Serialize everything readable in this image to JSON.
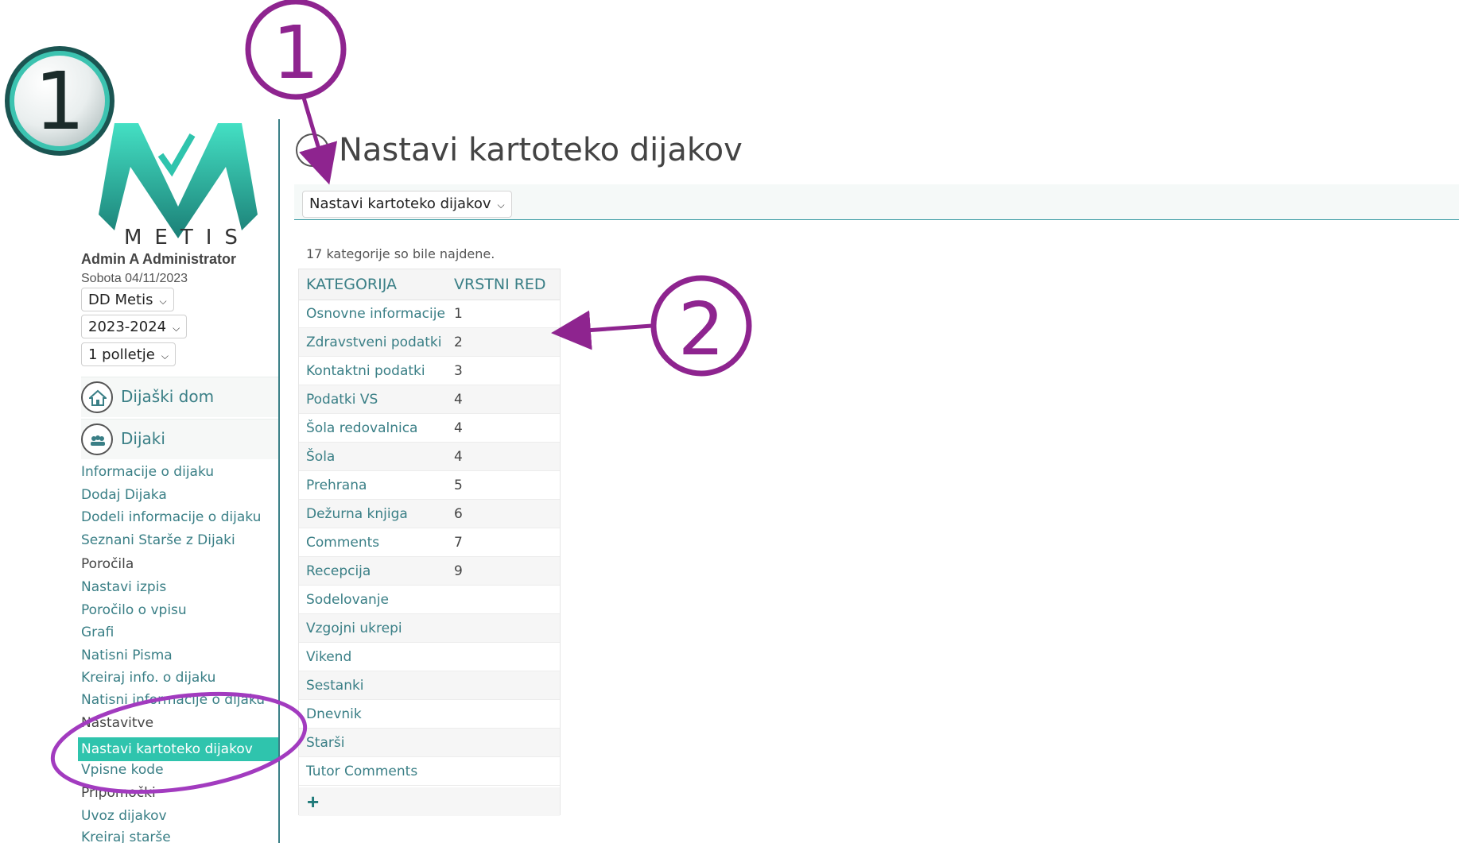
{
  "logo": {
    "word": "METIS"
  },
  "user": {
    "name": "Admin A Administrator",
    "date": "Sobota 04/11/2023"
  },
  "selectors": {
    "school": "DD Metis",
    "year": "2023-2024",
    "term": "1 polletje"
  },
  "sidebar": {
    "sections": [
      {
        "label": "Dijaški dom",
        "icon": "house-icon"
      },
      {
        "label": "Dijaki",
        "icon": "group-icon"
      }
    ],
    "links": [
      "Informacije o dijaku",
      "Dodaj Dijaka",
      "Dodeli informacije o dijaku",
      "Seznani Starše z Dijaki"
    ],
    "reports_head": "Poročila",
    "report_links": [
      "Nastavi izpis",
      "Poročilo o vpisu",
      "Grafi",
      "Natisni Pisma",
      "Kreiraj info. o dijaku",
      "Natisni informacije o dijaku"
    ],
    "settings_head": "Nastavitve",
    "active_item": "Nastavi kartoteko dijakov",
    "after_active": "Vpisne kode",
    "tools_head": "Pripomočki",
    "tools_links": [
      "Uvoz dijakov",
      "Kreiraj starše"
    ]
  },
  "main": {
    "title": "Nastavi kartoteko dijakov",
    "select_value": "Nastavi kartoteko dijakov",
    "found_text": "17 kategorije so bile najdene.",
    "table": {
      "headers": [
        "KATEGORIJA",
        "VRSTNI RED"
      ],
      "rows": [
        {
          "name": "Osnovne informacije",
          "order": "1"
        },
        {
          "name": "Zdravstveni podatki",
          "order": "2"
        },
        {
          "name": "Kontaktni podatki",
          "order": "3"
        },
        {
          "name": "Podatki VS",
          "order": "4"
        },
        {
          "name": "Šola redovalnica",
          "order": "4"
        },
        {
          "name": "Šola",
          "order": "4"
        },
        {
          "name": "Prehrana",
          "order": "5"
        },
        {
          "name": "Dežurna knjiga",
          "order": "6"
        },
        {
          "name": "Comments",
          "order": "7"
        },
        {
          "name": "Recepcija",
          "order": "9"
        },
        {
          "name": "Sodelovanje",
          "order": ""
        },
        {
          "name": "Vzgojni ukrepi",
          "order": ""
        },
        {
          "name": "Vikend",
          "order": ""
        },
        {
          "name": "Sestanki",
          "order": ""
        },
        {
          "name": "Dnevnik",
          "order": ""
        },
        {
          "name": "Starši",
          "order": ""
        },
        {
          "name": "Tutor Comments",
          "order": ""
        }
      ]
    }
  },
  "annotations": {
    "badge_number": "1",
    "callout_1": "1",
    "callout_2": "2",
    "colors": {
      "purple": "#8e248f",
      "teal": "#2fc4ad",
      "dark_teal": "#1b5552"
    }
  }
}
